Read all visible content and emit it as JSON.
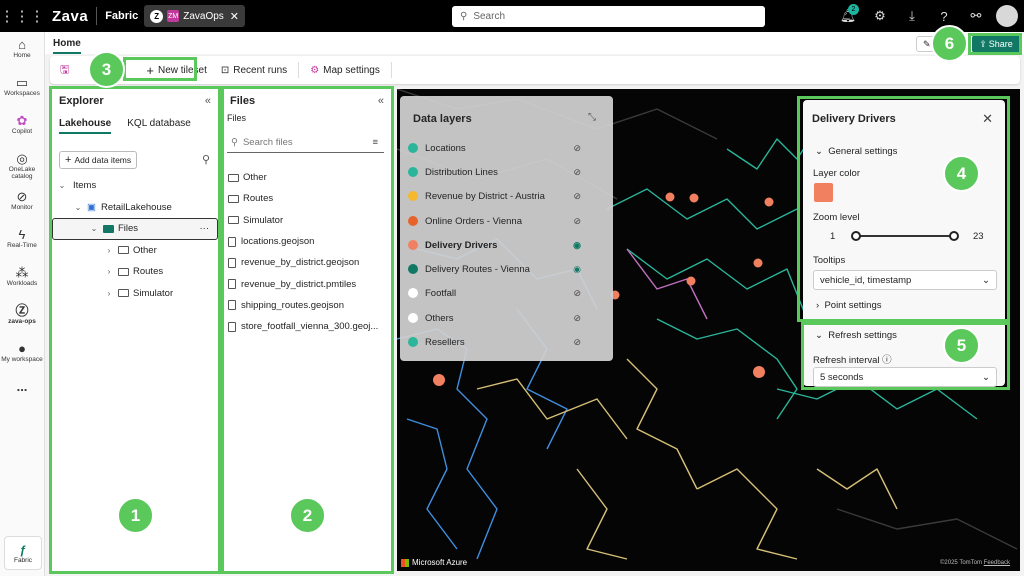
{
  "topbar": {
    "brand": "Zava",
    "product": "Fabric",
    "workspace_badge": "Z",
    "workspace_icon": "ZM",
    "workspace": "ZavaOps",
    "search_placeholder": "Search",
    "notification_count": "2"
  },
  "leftnav": {
    "items": [
      {
        "label": "Home",
        "icon": "home-icon"
      },
      {
        "label": "Workspaces",
        "icon": "workspaces-icon"
      },
      {
        "label": "Copilot",
        "icon": "copilot-icon"
      },
      {
        "label": "OneLake catalog",
        "icon": "onelake-icon"
      },
      {
        "label": "Monitor",
        "icon": "monitor-icon"
      },
      {
        "label": "Real-Time",
        "icon": "lightning-icon"
      },
      {
        "label": "Workloads",
        "icon": "workloads-icon"
      },
      {
        "label": "zava-ops",
        "icon": "zava-ops-icon"
      },
      {
        "label": "My workspace",
        "icon": "person-icon"
      }
    ],
    "more": "...",
    "fabric_label": "Fabric"
  },
  "tabs": {
    "home": "Home",
    "edit": "E",
    "share": "Share"
  },
  "toolbar": {
    "new_tileset": "New tileset",
    "recent_runs": "Recent runs",
    "map_settings": "Map settings"
  },
  "explorer": {
    "title": "Explorer",
    "tab_lakehouse": "Lakehouse",
    "tab_kql": "KQL database",
    "add_data": "Add data items",
    "items_label": "Items",
    "lakehouse": "RetailLakehouse",
    "files_folder": "Files",
    "subfolders": [
      "Other",
      "Routes",
      "Simulator"
    ]
  },
  "files_panel": {
    "title": "Files",
    "breadcrumb": "Files",
    "search_placeholder": "Search files",
    "folders": [
      "Other",
      "Routes",
      "Simulator"
    ],
    "files": [
      "locations.geojson",
      "revenue_by_district.geojson",
      "revenue_by_district.pmtiles",
      "shipping_routes.geojson",
      "store_footfall_vienna_300.geoj..."
    ]
  },
  "layers": {
    "title": "Data layers",
    "items": [
      {
        "name": "Locations",
        "color": "#2bb59a",
        "visible": false,
        "bold": false
      },
      {
        "name": "Distribution Lines",
        "color": "#2bb59a",
        "visible": false,
        "bold": false
      },
      {
        "name": "Revenue by District - Austria",
        "color": "#f5b82e",
        "visible": false,
        "bold": false
      },
      {
        "name": "Online Orders - Vienna",
        "color": "#e8632c",
        "visible": false,
        "bold": false
      },
      {
        "name": "Delivery Drivers",
        "color": "#f08060",
        "visible": true,
        "bold": true
      },
      {
        "name": "Delivery Routes - Vienna",
        "color": "#117865",
        "visible": true,
        "bold": false
      },
      {
        "name": "Footfall",
        "color": "#ffffff",
        "visible": false,
        "bold": false
      },
      {
        "name": "Others",
        "color": "#ffffff",
        "visible": false,
        "bold": false
      },
      {
        "name": "Resellers",
        "color": "#2bb59a",
        "visible": false,
        "bold": false
      }
    ]
  },
  "details": {
    "title": "Delivery Drivers",
    "general_settings": "General settings",
    "layer_color_label": "Layer color",
    "layer_color": "#f08060",
    "zoom_label": "Zoom level",
    "zoom_min": "1",
    "zoom_max": "23",
    "tooltips_label": "Tooltips",
    "tooltips_value": "vehicle_id, timestamp",
    "point_settings": "Point settings",
    "refresh_settings": "Refresh settings",
    "refresh_interval_label": "Refresh interval",
    "refresh_interval_value": "5 seconds"
  },
  "callouts": [
    "1",
    "2",
    "3",
    "4",
    "5",
    "6"
  ],
  "map": {
    "provider": "Microsoft Azure",
    "copyright": "©2025 TomTom",
    "feedback": "Feedback"
  },
  "colors": {
    "accent": "#117865",
    "highlight": "#5bc85b"
  }
}
